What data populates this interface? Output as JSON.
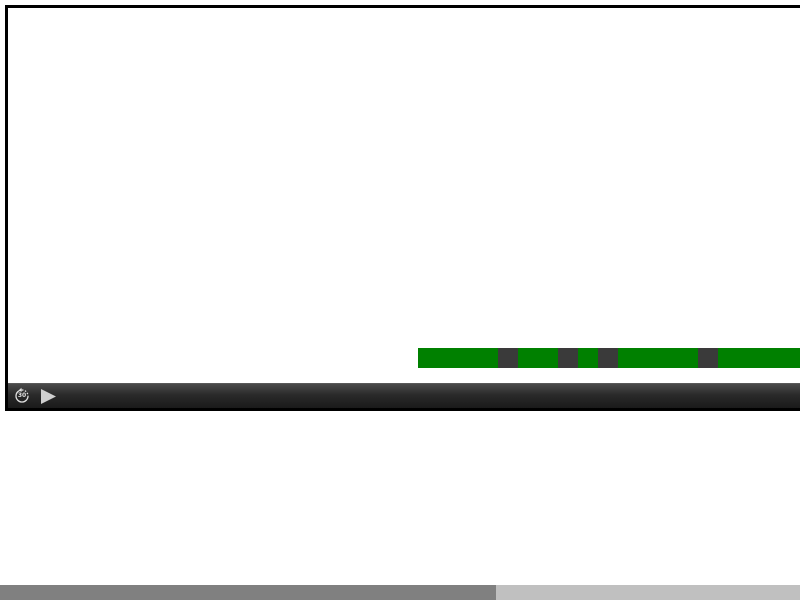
{
  "player": {
    "controls": {
      "replay": {
        "icon": "replay-30-icon",
        "label": "30"
      },
      "play": {
        "icon": "play-icon"
      }
    },
    "caption_bar": {
      "segments": [
        {
          "color": "#008000",
          "units": 4
        },
        {
          "color": "#3a3a3a",
          "units": 1
        },
        {
          "color": "#008000",
          "units": 2
        },
        {
          "color": "#3a3a3a",
          "units": 1
        },
        {
          "color": "#008000",
          "units": 1
        },
        {
          "color": "#3a3a3a",
          "units": 1
        },
        {
          "color": "#008000",
          "units": 4
        },
        {
          "color": "#3a3a3a",
          "units": 1
        },
        {
          "color": "#008000",
          "units": 4.1
        }
      ]
    }
  },
  "progress": {
    "fraction": 0.62,
    "fill_color": "#808080",
    "track_color": "#c0c0c0"
  }
}
